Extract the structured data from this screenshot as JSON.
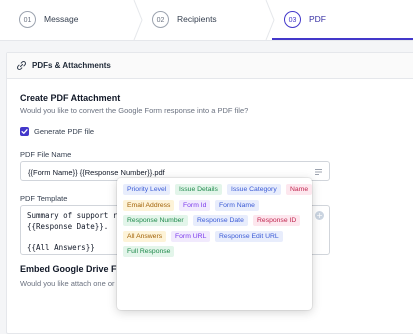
{
  "stepper": {
    "steps": [
      {
        "num": "01",
        "label": "Message"
      },
      {
        "num": "02",
        "label": "Recipients"
      },
      {
        "num": "03",
        "label": "PDF"
      }
    ]
  },
  "card": {
    "title": "PDFs & Attachments",
    "section_title": "Create PDF Attachment",
    "section_subtitle": "Would you like to convert the Google Form response into a PDF file?",
    "checkbox_label": "Generate PDF file",
    "checkbox_checked": true,
    "filename_label": "PDF File Name",
    "filename_value": "{{Form Name}} {{Response Number}}.pdf",
    "template_label": "PDF Template",
    "template_lines": [
      "Summary of support request # {{Response Number}} received on",
      "{{Response Date}}.",
      "",
      "{{All Answers}}"
    ],
    "embed_title": "Embed Google Drive Files",
    "embed_subtitle": "Would you like attach one or m"
  },
  "tags": [
    {
      "label": "Priority Level",
      "color": "#3b5bd6",
      "bg": "#e8edfc"
    },
    {
      "label": "Issue Details",
      "color": "#1f8a4c",
      "bg": "#e3f5ea"
    },
    {
      "label": "Issue Category",
      "color": "#3b5bd6",
      "bg": "#e8edfc"
    },
    {
      "label": "Name",
      "color": "#c0254f",
      "bg": "#fde7ee"
    },
    {
      "label": "Email Address",
      "color": "#a16207",
      "bg": "#fdf3d8"
    },
    {
      "label": "Form Id",
      "color": "#7c3aed",
      "bg": "#f1eafd"
    },
    {
      "label": "Form Name",
      "color": "#3b5bd6",
      "bg": "#e8edfc"
    },
    {
      "label": "Response Number",
      "color": "#1f8a4c",
      "bg": "#e3f5ea"
    },
    {
      "label": "Response Date",
      "color": "#3b5bd6",
      "bg": "#e8edfc"
    },
    {
      "label": "Response ID",
      "color": "#c0254f",
      "bg": "#fde7ee"
    },
    {
      "label": "All Answers",
      "color": "#a16207",
      "bg": "#fdf3d8"
    },
    {
      "label": "Form URL",
      "color": "#7c3aed",
      "bg": "#f1eafd"
    },
    {
      "label": "Response Edit URL",
      "color": "#3b5bd6",
      "bg": "#e8edfc"
    },
    {
      "label": "Full Response",
      "color": "#1f8a4c",
      "bg": "#e3f5ea"
    }
  ],
  "colors": {
    "accent": "#4338ca"
  },
  "icons": {
    "header": "link-icon",
    "filename_field": "menu-lines-icon",
    "template_field": "plus-circle-icon",
    "checkbox": "check-icon"
  }
}
